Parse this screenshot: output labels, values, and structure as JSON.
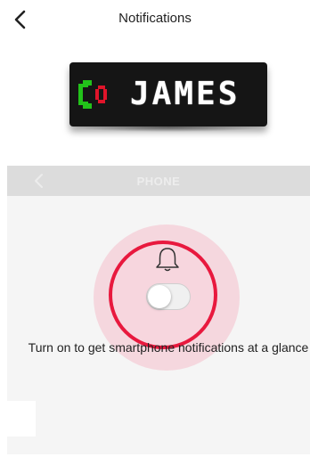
{
  "header": {
    "title": "Notifications"
  },
  "device": {
    "name_text": "JAMES",
    "icon": "phone-ringing-icon"
  },
  "section": {
    "title": "PHONE"
  },
  "setting": {
    "toggle_state": "off",
    "caption": "Turn on to get smartphone notifications at a glance"
  },
  "colors": {
    "highlight": "#e8193e",
    "phone_green": "#22c21a",
    "phone_red": "#e0142a"
  }
}
